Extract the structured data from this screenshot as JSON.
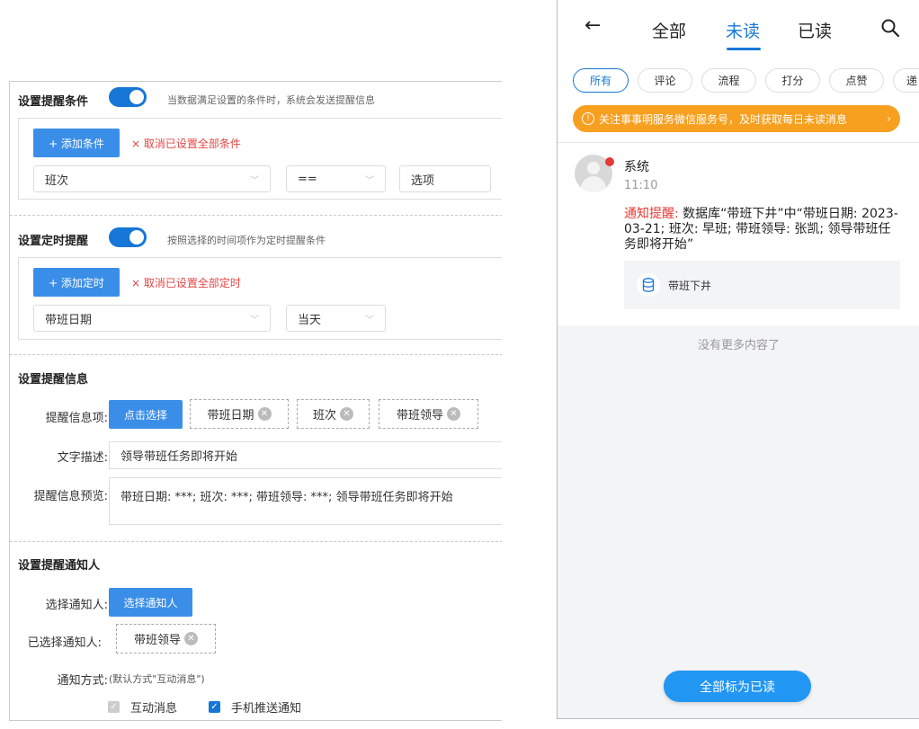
{
  "left": {
    "condition": {
      "title": "设置提醒条件",
      "hint": "当数据满足设置的条件时，系统会发送提醒信息",
      "add_button": "+ 添加条件",
      "cancel_link": "× 取消已设置全部条件",
      "field_select": "班次",
      "operator_select": "==",
      "value_input": "选项"
    },
    "timer": {
      "title": "设置定时提醒",
      "hint": "按照选择的时间项作为定时提醒条件",
      "add_button": "+ 添加定时",
      "cancel_link": "× 取消已设置全部定时",
      "date_select": "带班日期",
      "when_select": "当天"
    },
    "info": {
      "title": "设置提醒信息",
      "items_label": "提醒信息项:",
      "select_button": "点击选择",
      "tags": [
        "带班日期",
        "班次",
        "带班领导"
      ],
      "desc_label": "文字描述:",
      "desc_value": "领导带班任务即将开始",
      "preview_label": "提醒信息预览:",
      "preview_value": "带班日期: ***;  班次: ***;  带班领导: ***;  领导带班任务即将开始"
    },
    "notify": {
      "title": "设置提醒通知人",
      "choose_label": "选择通知人:",
      "choose_button": "选择通知人",
      "chosen_label": "已选择通知人:",
      "chosen_tag": "带班领导",
      "method_label": "通知方式:",
      "method_note": "(默认方式\"互动消息\")",
      "options": [
        {
          "label": "互动消息",
          "checked": true,
          "disabled": true
        },
        {
          "label": "手机推送通知",
          "checked": true,
          "disabled": false
        }
      ]
    }
  },
  "right": {
    "tabs": [
      "全部",
      "未读",
      "已读"
    ],
    "active_tab": "未读",
    "filters": [
      "所有",
      "评论",
      "流程",
      "打分",
      "点赞",
      "递"
    ],
    "banner": "关注事事明服务微信服务号，及时获取每日未读消息",
    "message": {
      "sender": "系统",
      "time": "11:10",
      "prefix": "通知提醒:",
      "body": "数据库“带班下井”中“带班日期: 2023-03-21; 班次: 早班; 带班领导: 张凯; 领导带班任务即将开始”",
      "attachment": "带班下井"
    },
    "no_more": "没有更多内容了",
    "mark_all_button": "全部标为已读",
    "colors": {
      "accent": "#1677d6",
      "banner": "#f7a020",
      "red": "#e53935"
    }
  }
}
